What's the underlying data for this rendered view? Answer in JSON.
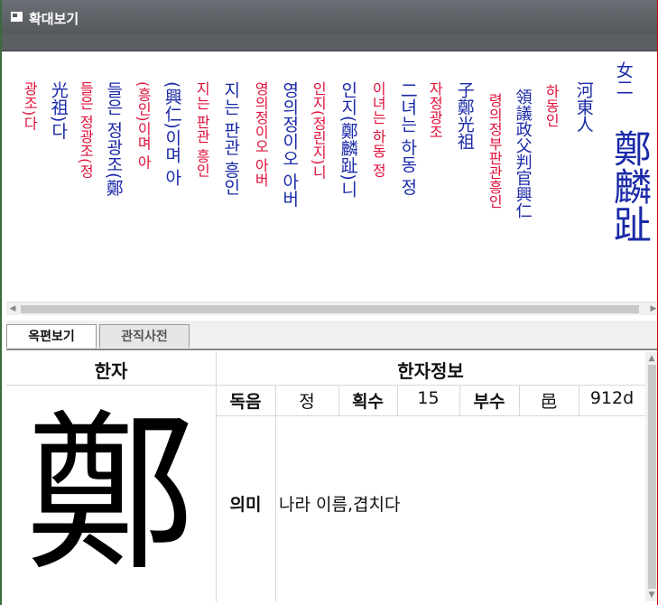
{
  "window": {
    "title": "확대보기"
  },
  "columns": [
    {
      "text": "女二",
      "color": "blue"
    },
    {
      "text": "鄭麟趾",
      "color": "blue"
    },
    {
      "text": "河東人",
      "color": "blue"
    },
    {
      "text": "하동인",
      "color": "red"
    },
    {
      "text": "領議政父判官興仁",
      "color": "blue"
    },
    {
      "text": "령의정부판관흥인",
      "color": "red"
    },
    {
      "text": "子鄭光祖",
      "color": "blue"
    },
    {
      "text": "자정광조",
      "color": "red"
    },
    {
      "text": "二녀는 하동 정",
      "color": "blue"
    },
    {
      "text": "이녀는 하동 정",
      "color": "red"
    },
    {
      "text": "인지(鄭麟趾)니",
      "color": "blue"
    },
    {
      "text": "인지(정린지)니",
      "color": "red"
    },
    {
      "text": "영의정이오 아버",
      "color": "blue"
    },
    {
      "text": "영의정이오 아버",
      "color": "red"
    },
    {
      "text": "지는 판관 흥인",
      "color": "blue"
    },
    {
      "text": "지는 판관 흥인",
      "color": "red"
    },
    {
      "text": "(興仁)이며 아",
      "color": "blue"
    },
    {
      "text": "(흥인)이며 아",
      "color": "red"
    },
    {
      "text": "들은 정광조(鄭",
      "color": "blue"
    },
    {
      "text": "들은 정광조(정",
      "color": "red"
    },
    {
      "text": "光祖)다",
      "color": "blue"
    },
    {
      "text": "광조)다",
      "color": "red"
    }
  ],
  "tabs": [
    {
      "label": "옥편보기",
      "active": true
    },
    {
      "label": "관직사전",
      "active": false
    }
  ],
  "info": {
    "header_hanja": "한자",
    "header_info": "한자정보",
    "big_char": "鄭",
    "reading_label": "독음",
    "reading_value": "정",
    "strokes_label": "획수",
    "strokes_value": "15",
    "radical_label": "부수",
    "radical_value": "邑",
    "code_value": "912d",
    "meaning_label": "의미",
    "meaning_value": "나라 이름,겹치다"
  }
}
